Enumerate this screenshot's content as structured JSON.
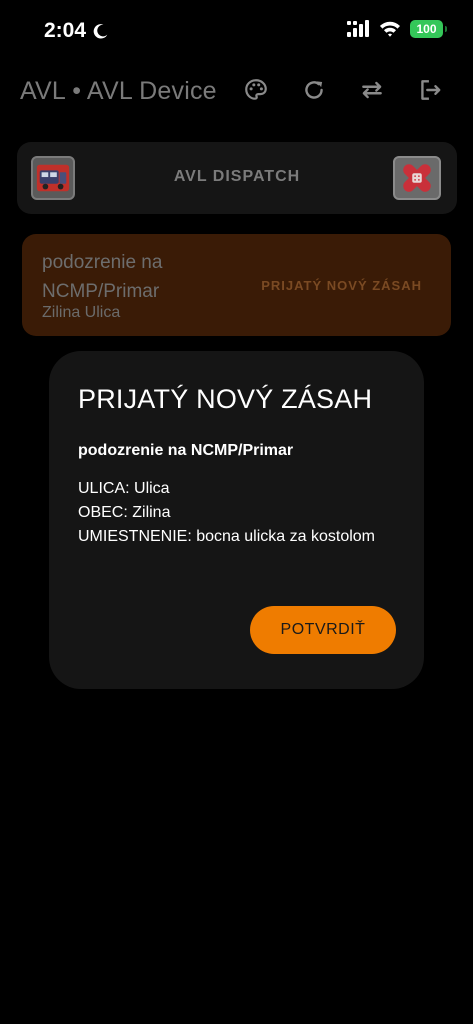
{
  "status_bar": {
    "time": "2:04",
    "battery": "100",
    "icons": [
      "moon-icon",
      "signal-icon",
      "wifi-icon",
      "battery-icon"
    ]
  },
  "app_bar": {
    "title": "AVL • AVL Device",
    "actions": [
      {
        "name": "palette-icon"
      },
      {
        "name": "refresh-icon"
      },
      {
        "name": "swap-icon"
      },
      {
        "name": "logout-icon"
      }
    ]
  },
  "dispatch": {
    "title": "AVL DISPATCH",
    "left_logo": "ambulance-logo",
    "right_logo": "bandage-logo"
  },
  "incident": {
    "name": "podozrenie na NCMP/Primar",
    "location": "Zilina Ulica",
    "status": "PRIJATÝ NOVÝ ZÁSAH"
  },
  "dialog": {
    "title": "PRIJATÝ NOVÝ ZÁSAH",
    "subtitle": "podozrenie na NCMP/Primar",
    "lines": [
      "ULICA: Ulica",
      "OBEC: Zilina",
      "UMIESTNENIE: bocna ulicka za kostolom"
    ],
    "confirm_label": "POTVRDIŤ"
  },
  "colors": {
    "background": "#000000",
    "accent": "#ef7c00",
    "incident_card": "#3a1b06",
    "dialog": "#151515",
    "battery": "#34c759"
  }
}
